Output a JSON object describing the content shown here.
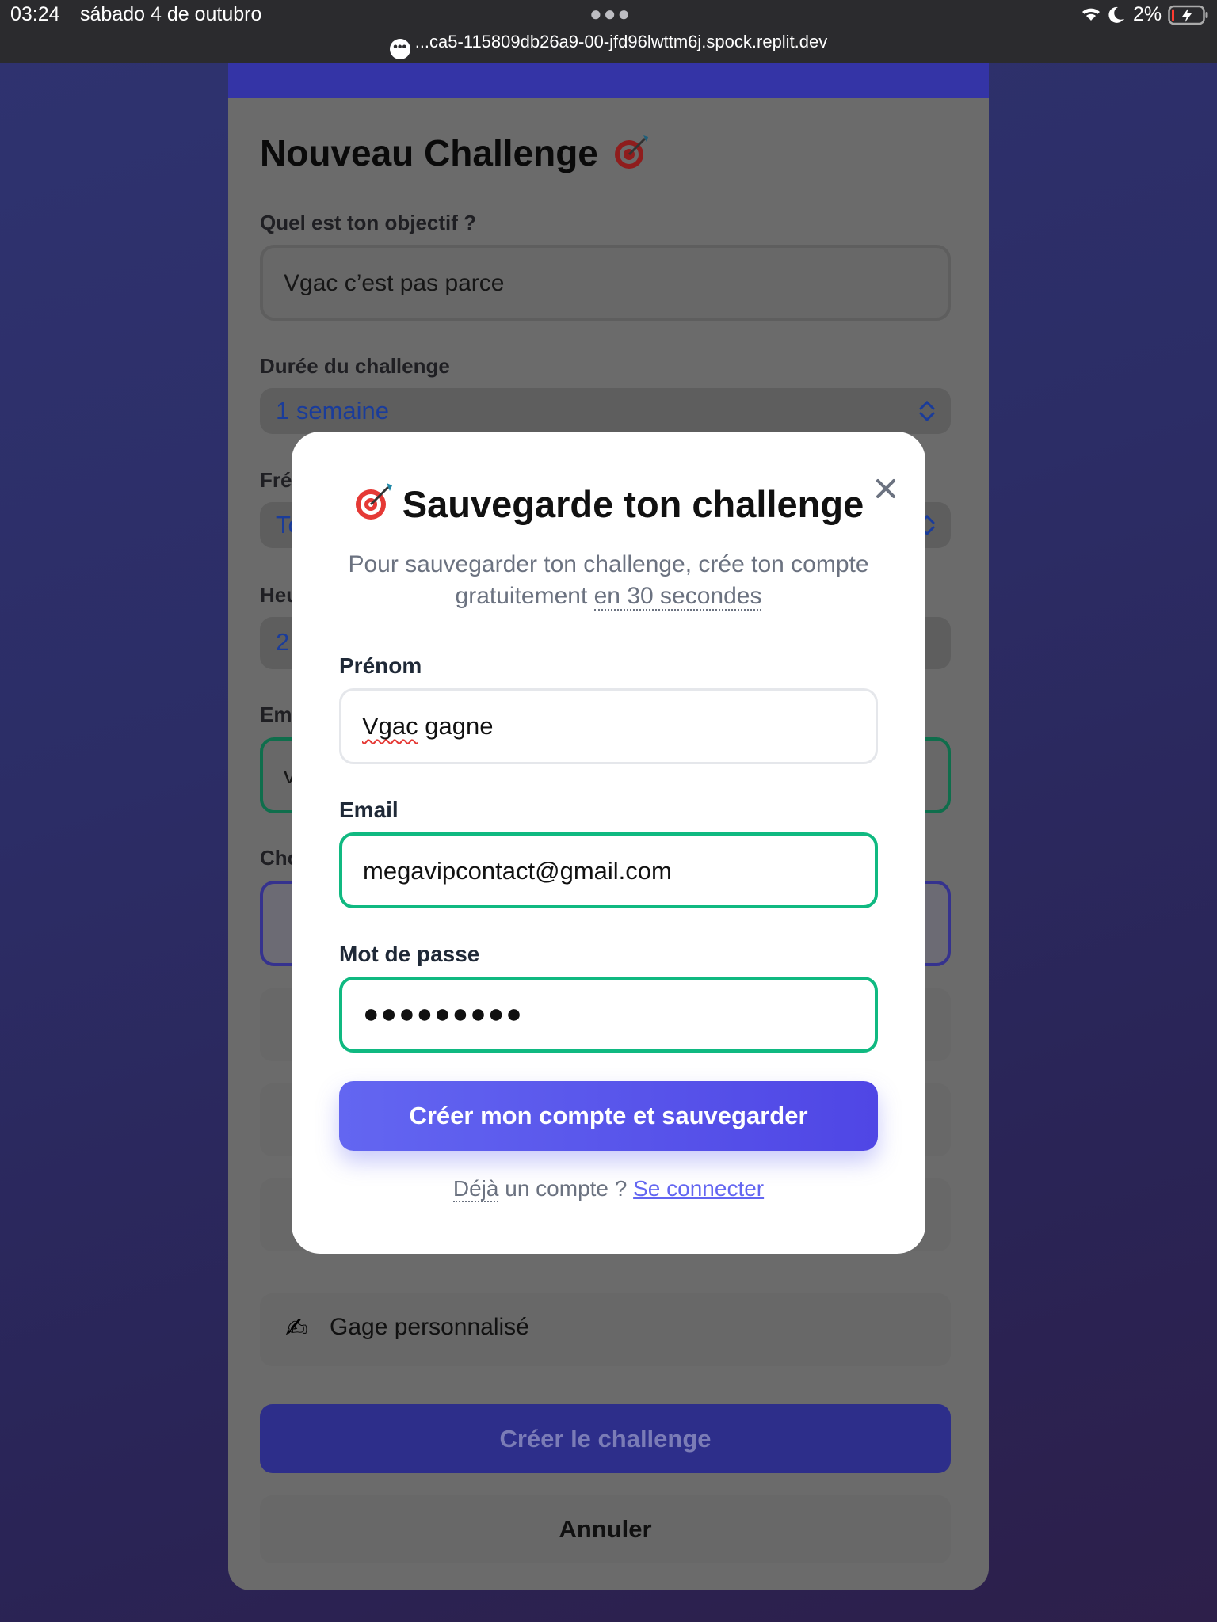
{
  "status_bar": {
    "time": "03:24",
    "date": "sábado 4 de outubro",
    "battery": "2%",
    "url": "...ca5-115809db26a9-00-jfd96lwttm6j.spock.replit.dev",
    "icons": [
      "wifi-icon",
      "moon-icon",
      "battery-icon",
      "more-dots-icon",
      "site-settings-icon"
    ]
  },
  "background_form": {
    "title": "Nouveau Challenge",
    "title_icon": "target-icon",
    "objective": {
      "label": "Quel est ton objectif ?",
      "value": "Vgac c’est pas parce"
    },
    "duration": {
      "label": "Durée du challenge",
      "value": "1 semaine"
    },
    "frequency": {
      "label_partial": "Fré",
      "value_partial": "To"
    },
    "hour": {
      "label_partial": "Heu",
      "value_partial": "2"
    },
    "email": {
      "label_partial": "Em",
      "value_partial": "v"
    },
    "choice": {
      "label_partial": "Cho"
    },
    "custom_pledge": {
      "icon": "writing-hand-icon",
      "label": "Gage personnalisé"
    },
    "create_button": "Créer le challenge",
    "cancel_button": "Annuler"
  },
  "modal": {
    "title": "Sauvegarde ton challenge",
    "title_icon": "target-icon",
    "subtitle_part1": "Pour sauvegarder ton challenge, crée ton compte gratuitement",
    "subtitle_part2": "en 30 secondes",
    "firstname": {
      "label": "Prénom",
      "value_word1": "Vgac",
      "value_rest": " gagne"
    },
    "email": {
      "label": "Email",
      "value": "megavipcontact@gmail.com"
    },
    "password": {
      "label": "Mot de passe",
      "value": "●●●●●●●●●"
    },
    "submit_button": "Créer mon compte et sauvegarder",
    "footer_prefix_word": "Déjà",
    "footer_prefix_rest": " un compte ?",
    "login_link": "Se connecter",
    "close_icon": "close-icon"
  },
  "colors": {
    "accent": "#6366f1",
    "focus_green": "#10b981",
    "link": "#6366f1"
  }
}
